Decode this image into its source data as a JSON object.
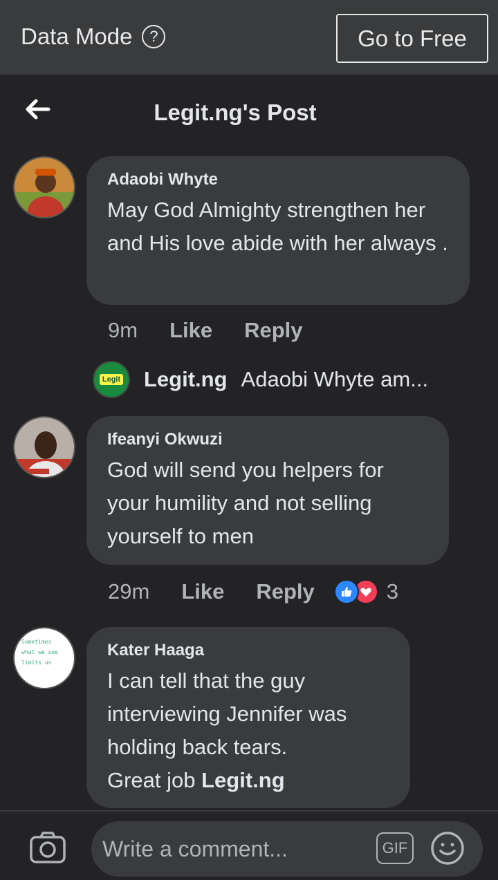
{
  "top_bar": {
    "mode_label": "Data Mode",
    "help_icon": "?",
    "go_free_label": "Go to Free"
  },
  "header": {
    "back_icon": "arrow-left-icon",
    "title": "Legit.ng's Post"
  },
  "comments": [
    {
      "author": "Adaobi Whyte",
      "text": "May God Almighty strengthen her and His love abide with her always .",
      "time": "9m",
      "like_label": "Like",
      "reply_label": "Reply"
    },
    {
      "author": "Ifeanyi Okwuzi",
      "text": "God will send you helpers for your humility and not selling yourself to men",
      "time": "29m",
      "like_label": "Like",
      "reply_label": "Reply",
      "reaction_count": "3"
    },
    {
      "author": "Kater Haaga",
      "text_line1": "I can tell that the guy interviewing Jennifer was holding back tears.",
      "text_line2_prefix": "Great job ",
      "text_line2_bold": "Legit.ng"
    }
  ],
  "reply_preview": {
    "author": "Legit.ng",
    "text": "Adaobi Whyte am...",
    "avatar_logo": "Legit"
  },
  "avatar3_text": "Sometimes what we see limits us",
  "composer": {
    "placeholder": "Write a comment...",
    "gif_label": "GIF"
  },
  "colors": {
    "background": "#232325",
    "bubble": "#3a3b3c",
    "like_blue": "#2d88ff",
    "love_red": "#f33e58"
  }
}
